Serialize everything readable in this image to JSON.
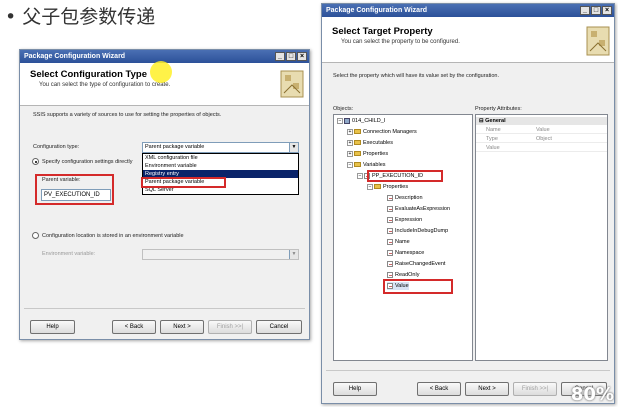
{
  "slide": {
    "title": "• 父子包参数传递",
    "watermark": "80%"
  },
  "left": {
    "window_title": "Package Configuration Wizard",
    "title_buttons": [
      "_",
      "□",
      "×"
    ],
    "header_title": "Select Configuration Type",
    "header_subtitle": "You can select the type of configuration to create.",
    "intro": "SSIS supports a variety of sources to use for setting the properties of objects.",
    "config_type_label": "Configuration type:",
    "config_type_value": "Parent package variable",
    "dropdown_options": [
      "XML configuration file",
      "Environment variable",
      "Registry entry",
      "Parent package variable",
      "SQL Server"
    ],
    "dropdown_selected_index": 2,
    "radio_specify": "Specify configuration settings directly",
    "parent_variable_label": "Parent variable:",
    "parent_variable_value": "PV_EXECUTION_ID",
    "radio_env": "Configuration location is stored in an environment variable",
    "env_var_label": "Environment variable:",
    "buttons": {
      "help": "Help",
      "back": "< Back",
      "next": "Next >",
      "finish": "Finish >>|",
      "cancel": "Cancel"
    }
  },
  "right": {
    "window_title": "Package Configuration Wizard",
    "title_buttons": [
      "_",
      "□",
      "×"
    ],
    "header_title": "Select Target Property",
    "header_subtitle": "You can select the property to be configured.",
    "intro": "Select the property which will have its value set by the configuration.",
    "objects_label": "Objects:",
    "attributes_label": "Property Attributes:",
    "tree": {
      "root": "014_CHILD_I",
      "connection_managers": "Connection Managers",
      "executables": "Executables",
      "properties": "Properties",
      "variables": "Variables",
      "variable": "PP_EXECUTION_ID",
      "var_properties": "Properties",
      "props": [
        "Description",
        "EvaluateAsExpression",
        "Expression",
        "IncludeInDebugDump",
        "Name",
        "Namespace",
        "RaiseChangedEvent",
        "ReadOnly"
      ],
      "selected": "Value"
    },
    "attributes": {
      "group": "General",
      "rows": [
        {
          "k": "Name",
          "v": "Value"
        },
        {
          "k": "Type",
          "v": "Object"
        },
        {
          "k": "Value",
          "v": ""
        }
      ]
    },
    "buttons": {
      "help": "Help",
      "back": "< Back",
      "next": "Next >",
      "finish": "Finish >>|",
      "cancel": "Cancel"
    }
  }
}
